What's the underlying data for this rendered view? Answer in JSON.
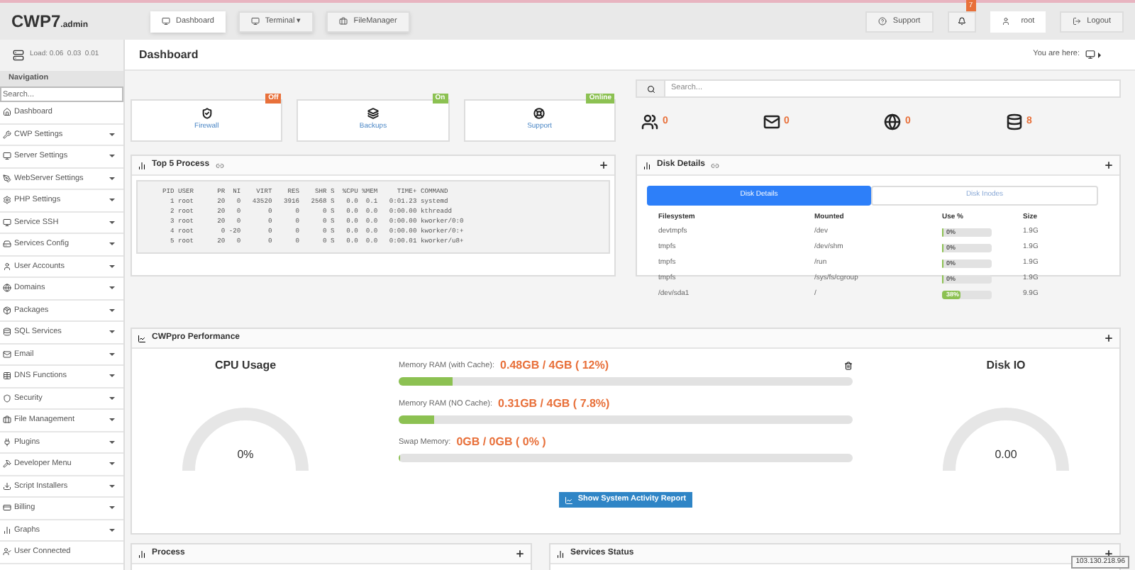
{
  "topbar": {
    "logo": "CWP7",
    "logo_suffix": ".admin",
    "nav": [
      {
        "label": "Dashboard",
        "selected": true
      },
      {
        "label": "Terminal ▾",
        "selected": false
      },
      {
        "label": "FileManager",
        "selected": false
      }
    ],
    "support": "Support",
    "notifications": "7",
    "user": "root",
    "logout": "Logout"
  },
  "sidebar": {
    "load": "Load: 0.06  0.03  0.01",
    "header": "Navigation",
    "search_placeholder": "Search...",
    "items": [
      {
        "label": "Dashboard",
        "expandable": false
      },
      {
        "label": "CWP Settings",
        "expandable": true
      },
      {
        "label": "Server Settings",
        "expandable": true
      },
      {
        "label": "WebServer Settings",
        "expandable": true
      },
      {
        "label": "PHP Settings",
        "expandable": true
      },
      {
        "label": "Service SSH",
        "expandable": true
      },
      {
        "label": "Services Config",
        "expandable": true
      },
      {
        "label": "User Accounts",
        "expandable": true
      },
      {
        "label": "Domains",
        "expandable": true
      },
      {
        "label": "Packages",
        "expandable": true
      },
      {
        "label": "SQL Services",
        "expandable": true
      },
      {
        "label": "Email",
        "expandable": true
      },
      {
        "label": "DNS Functions",
        "expandable": true
      },
      {
        "label": "Security",
        "expandable": true
      },
      {
        "label": "File Management",
        "expandable": true
      },
      {
        "label": "Plugins",
        "expandable": true
      },
      {
        "label": "Developer Menu",
        "expandable": true
      },
      {
        "label": "Script Installers",
        "expandable": true
      },
      {
        "label": "Billing",
        "expandable": true
      },
      {
        "label": "Graphs",
        "expandable": true
      },
      {
        "label": "User Connected",
        "expandable": false
      }
    ]
  },
  "page": {
    "title": "Dashboard",
    "breadcrumb": "You are here:"
  },
  "status_cards": [
    {
      "label": "Firewall",
      "badge": "Off",
      "color": "#e8703a"
    },
    {
      "label": "Backups",
      "badge": "On",
      "color": "#8cc152"
    },
    {
      "label": "Support",
      "badge": "Online",
      "color": "#8cc152"
    }
  ],
  "search": {
    "placeholder": "Search..."
  },
  "stats": [
    "0",
    "0",
    "0",
    "8"
  ],
  "top_process": {
    "title": "Top 5 Process",
    "lines": [
      "  PID USER      PR  NI    VIRT    RES    SHR S  %CPU %MEM     TIME+ COMMAND",
      "    1 root      20   0   43520   3916   2568 S   0.0  0.1   0:01.23 systemd",
      "    2 root      20   0       0      0      0 S   0.0  0.0   0:00.00 kthreadd",
      "    3 root      20   0       0      0      0 S   0.0  0.0   0:00.00 kworker/0:0",
      "    4 root       0 -20       0      0      0 S   0.0  0.0   0:00.00 kworker/0:+",
      "    5 root      20   0       0      0      0 S   0.0  0.0   0:00.01 kworker/u8+"
    ]
  },
  "disk_details": {
    "title": "Disk Details",
    "tabs": [
      {
        "label": "Disk Details",
        "selected": true
      },
      {
        "label": "Disk Inodes",
        "selected": false
      }
    ],
    "columns": [
      "Filesystem",
      "Mounted",
      "Use %",
      "Size"
    ],
    "rows": [
      {
        "filesystem": "devtmpfs",
        "mounted": "/dev",
        "use": "0%",
        "level": 0,
        "size": "1.9G"
      },
      {
        "filesystem": "tmpfs",
        "mounted": "/dev/shm",
        "use": "0%",
        "level": 0,
        "size": "1.9G"
      },
      {
        "filesystem": "tmpfs",
        "mounted": "/run",
        "use": "0%",
        "level": 0,
        "size": "1.9G"
      },
      {
        "filesystem": "tmpfs",
        "mounted": "/sys/fs/cgroup",
        "use": "0%",
        "level": 0,
        "size": "1.9G"
      },
      {
        "filesystem": "/dev/sda1",
        "mounted": "/",
        "use": "38%",
        "level": 0.38,
        "size": "9.9G"
      }
    ]
  },
  "performance": {
    "title": "CWPpro Performance",
    "cpu": {
      "title": "CPU Usage",
      "value": "0%"
    },
    "disk_io": {
      "title": "Disk IO",
      "value": "0.00"
    },
    "memory": [
      {
        "label": "Memory RAM (with Cache):",
        "value": "0.48GB / 4GB ( 12%)",
        "level": 0.12
      },
      {
        "label": "Memory RAM (NO Cache):",
        "value": "0.31GB / 4GB ( 7.8%)",
        "level": 0.078
      },
      {
        "label": "Swap Memory:",
        "value": "0GB / 0GB ( 0% )",
        "level": 0
      }
    ],
    "report_button": "Show System Activity Report"
  },
  "bottom_panels": [
    {
      "title": "Process"
    },
    {
      "title": "Services Status"
    }
  ],
  "ip_tooltip": "103.130.218.96"
}
